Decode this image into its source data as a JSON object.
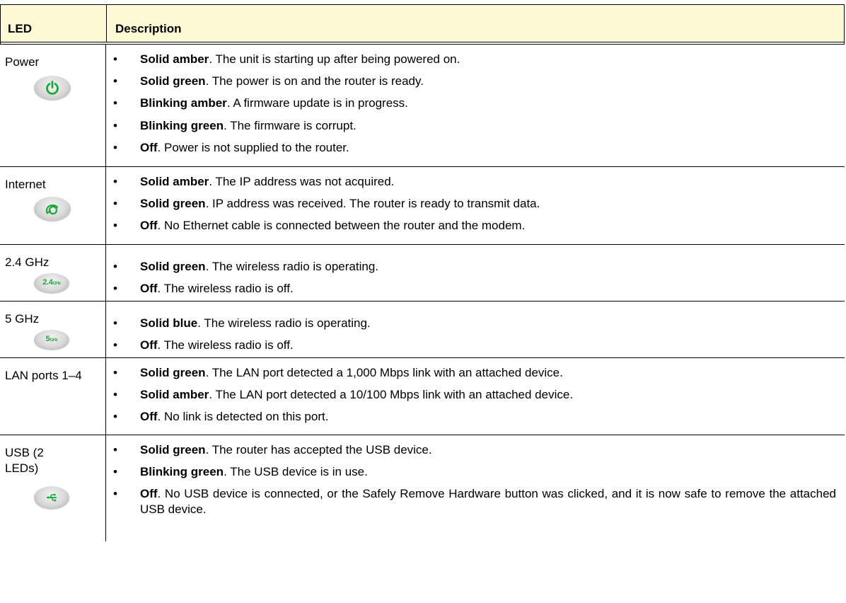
{
  "header": {
    "col1": "LED",
    "col2": "Description"
  },
  "rows": [
    {
      "led": "Power",
      "icon": "power-icon",
      "items": [
        {
          "strong": "Solid amber",
          "text": ". The unit is starting up after being powered on."
        },
        {
          "strong": "Solid green",
          "text": ". The power is on and the router is ready."
        },
        {
          "strong": "Blinking amber",
          "text": ". A firmware update is in progress."
        },
        {
          "strong": "Blinking green",
          "text": ". The firmware is corrupt."
        },
        {
          "strong": "Off",
          "text": ". Power is not supplied to the router."
        }
      ]
    },
    {
      "led": "Internet",
      "icon": "internet-icon",
      "items": [
        {
          "strong": "Solid amber",
          "text": ". The IP address was not acquired."
        },
        {
          "strong": "Solid green",
          "text": ". IP address was received. The router is ready to transmit data."
        },
        {
          "strong": "Off",
          "text": ". No Ethernet cable is connected between the router and the modem."
        }
      ]
    },
    {
      "led": "2.4 GHz",
      "icon": "wifi-2-4ghz-icon",
      "icon_label": "2.4",
      "icon_unit": "GHz",
      "items": [
        {
          "strong": "Solid green",
          "text": ". The wireless radio is operating."
        },
        {
          "strong": "Off",
          "text": ". The wireless radio is off."
        }
      ]
    },
    {
      "led": "5 GHz",
      "icon": "wifi-5ghz-icon",
      "icon_label": "5",
      "icon_unit": "GHz",
      "items": [
        {
          "strong": "Solid blue",
          "text": ". The wireless radio is operating."
        },
        {
          "strong": "Off",
          "text": ". The wireless radio is off."
        }
      ]
    },
    {
      "led": "LAN ports 1–4",
      "items": [
        {
          "strong": "Solid green",
          "text": ". The LAN port detected a 1,000 Mbps link with an attached device."
        },
        {
          "strong": "Solid amber",
          "text": ". The LAN port detected a 10/100 Mbps link with an attached device."
        },
        {
          "strong": "Off",
          "text": ". No link is detected on this port."
        }
      ]
    },
    {
      "led": "USB (2 LEDs)",
      "icon": "usb-icon",
      "items": [
        {
          "strong": "Solid green",
          "text": ". The router has accepted the USB device."
        },
        {
          "strong": "Blinking green",
          "text": ". The USB device is in use."
        },
        {
          "strong": "Off",
          "text": ". No USB device is connected, or the Safely Remove Hardware button was clicked, and it is now safe to remove the attached USB device."
        }
      ]
    }
  ],
  "bullet": "•",
  "colors": {
    "header_bg": "#fdf9d4",
    "led_green": "#1aa83a"
  }
}
